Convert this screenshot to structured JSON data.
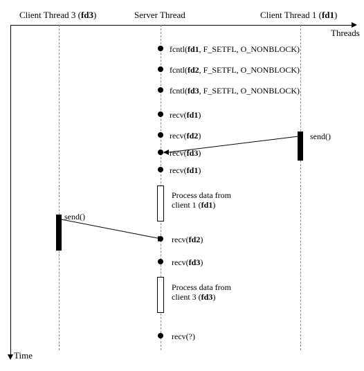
{
  "axes": {
    "threads": "Threads",
    "time": "Time"
  },
  "columns": {
    "client3": {
      "text": "Client Thread 3",
      "fd": "fd3"
    },
    "server": {
      "text": "Server Thread"
    },
    "client1": {
      "text": "Client Thread 1",
      "fd": "fd1"
    }
  },
  "events": {
    "fcntl1": {
      "fn": "fcntl",
      "fd": "fd1",
      "args": "F_SETFL, O_NONBLOCK"
    },
    "fcntl2": {
      "fn": "fcntl",
      "fd": "fd2",
      "args": "F_SETFL, O_NONBLOCK"
    },
    "fcntl3": {
      "fn": "fcntl",
      "fd": "fd3",
      "args": "F_SETFL, O_NONBLOCK"
    },
    "recv1a": {
      "fn": "recv",
      "fd": "fd1"
    },
    "recv2a": {
      "fn": "recv",
      "fd": "fd2"
    },
    "recv3a": {
      "fn": "recv",
      "fd": "fd3"
    },
    "recv1b": {
      "fn": "recv",
      "fd": "fd1"
    },
    "recv2b": {
      "fn": "recv",
      "fd": "fd2"
    },
    "recv3b": {
      "fn": "recv",
      "fd": "fd3"
    },
    "recvq": {
      "fn": "recv",
      "fd": "?"
    }
  },
  "process": {
    "p1": {
      "line1": "Process data from",
      "line2a": "client 1",
      "fd": "fd1"
    },
    "p2": {
      "line1": "Process data from",
      "line2a": "client 3",
      "fd": "fd3"
    }
  },
  "messages": {
    "send1": {
      "label": "send()"
    },
    "send3": {
      "label": "send()"
    }
  }
}
